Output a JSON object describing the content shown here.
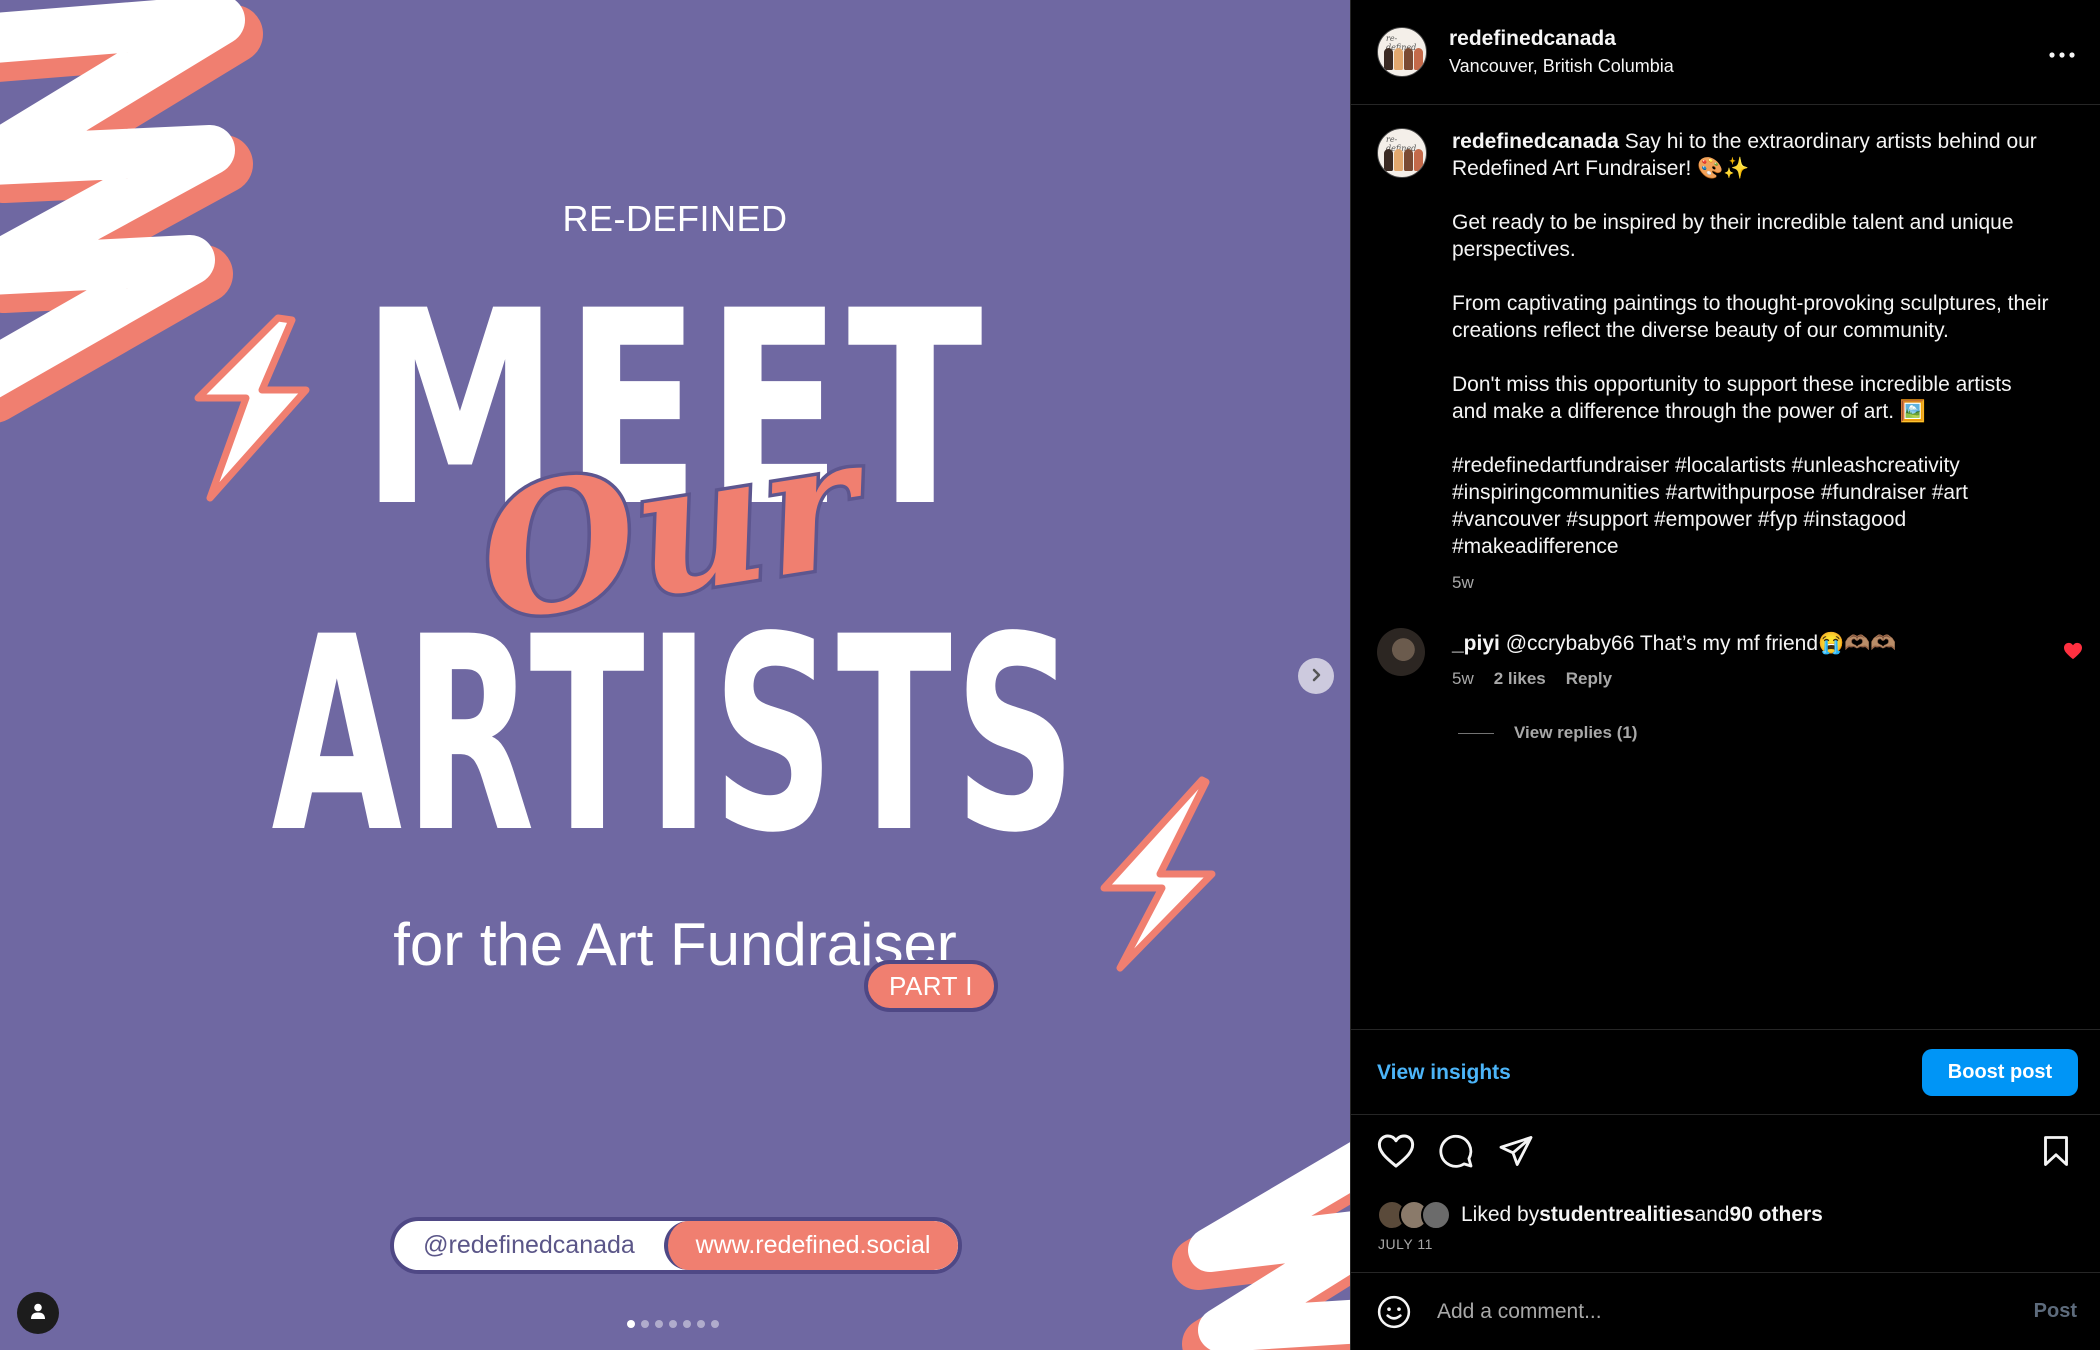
{
  "colors": {
    "media_bg": "#6f68a2",
    "accent_coral": "#f07f70",
    "link_blue": "#4cb5f9",
    "boost_blue": "#0095f6",
    "liked_red": "#ff3040"
  },
  "media": {
    "brand": "RE-DEFINED",
    "line1": "MEET",
    "script_word": "Our",
    "line2": "ARTISTS",
    "subline": "for the Art Fundraiser",
    "part_badge": "PART I",
    "handle": "@redefinedcanada",
    "website": "www.redefined.social",
    "carousel": {
      "count": 7,
      "active": 1
    },
    "next_icon": "chevron-right-icon",
    "tag_icon": "person-tag-icon"
  },
  "header": {
    "username": "redefinedcanada",
    "location": "Vancouver, British Columbia",
    "more_icon": "more-horizontal-icon"
  },
  "caption": {
    "username": "redefinedcanada",
    "text": " Say hi to the extraordinary artists behind our Redefined Art Fundraiser! 🎨✨\n\nGet ready to be inspired by their incredible talent and unique perspectives.\n\nFrom captivating paintings to thought-provoking sculptures, their creations reflect the diverse beauty of our community.\n\nDon't miss this opportunity to support these incredible artists and make a difference through the power of art. 🖼️\n\n#redefinedartfundraiser #localartists #unleashcreativity #inspiringcommunities #artwithpurpose #fundraiser #art #vancouver #support #empower #fyp #instagood #makeadifference",
    "time": "5w"
  },
  "comment": {
    "username": "_piyi",
    "text": " @ccrybaby66 That’s my mf friend😭🫶🏽🫶🏽",
    "time": "5w",
    "likes": "2 likes",
    "reply": "Reply",
    "view_replies": "View replies (1)",
    "liked": true
  },
  "insights": {
    "view_insights": "View insights",
    "boost": "Boost post"
  },
  "actions": {
    "like_icon": "heart-icon",
    "comment_icon": "comment-icon",
    "share_icon": "share-icon",
    "save_icon": "bookmark-icon"
  },
  "likes": {
    "prefix": "Liked by ",
    "user": "studentrealities",
    "middle": " and ",
    "others": "90 others"
  },
  "date": "JULY 11",
  "add_comment": {
    "placeholder": "Add a comment...",
    "post": "Post",
    "emoji_icon": "emoji-icon"
  }
}
